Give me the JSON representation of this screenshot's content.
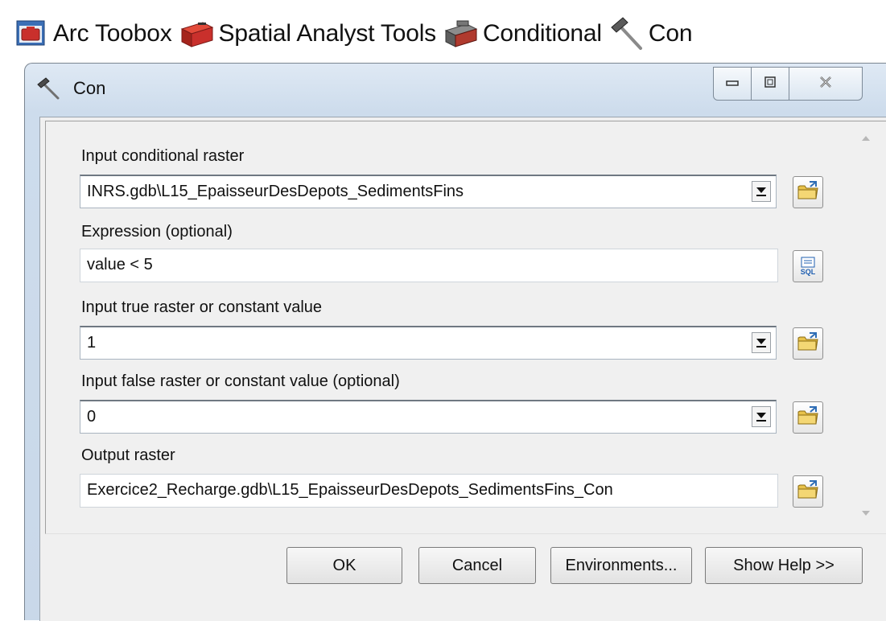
{
  "breadcrumb": {
    "items": [
      {
        "label": "Arc Toobox",
        "icon": "arctoolbox-icon"
      },
      {
        "label": "Spatial Analyst Tools",
        "icon": "toolbox-icon"
      },
      {
        "label": "Conditional",
        "icon": "toolset-icon"
      },
      {
        "label": "Con",
        "icon": "hammer-icon"
      }
    ]
  },
  "dialog": {
    "title": "Con",
    "title_icon": "hammer-icon",
    "window_buttons": [
      "minimize-icon",
      "maximize-icon",
      "close-icon"
    ]
  },
  "fields": {
    "input_conditional_raster": {
      "label": "Input conditional raster",
      "value": "INRS.gdb\\L15_EpaisseurDesDepots_SedimentsFins"
    },
    "expression": {
      "label": "Expression (optional)",
      "value": "value < 5"
    },
    "input_true": {
      "label": "Input true raster or constant value",
      "value": "1"
    },
    "input_false": {
      "label": "Input false raster or constant value (optional)",
      "value": "0"
    },
    "output_raster": {
      "label": "Output raster",
      "value": "Exercice2_Recharge.gdb\\L15_EpaisseurDesDepots_SedimentsFins_Con"
    }
  },
  "buttons": {
    "ok": "OK",
    "cancel": "Cancel",
    "environments": "Environments...",
    "show_help": "Show Help >>",
    "sql_label": "SQL"
  },
  "colors": {
    "title_bar": "#cddcec",
    "client_bg": "#f0f0f0",
    "folder_yellow": "#e8c24a"
  }
}
